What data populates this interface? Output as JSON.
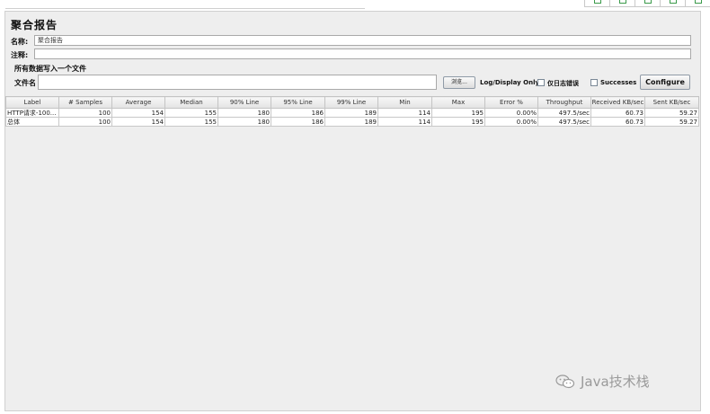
{
  "panel": {
    "title": "聚合报告",
    "name_label": "名称:",
    "name_value": "聚合报告",
    "comment_label": "注释:",
    "comment_value": "",
    "file_section_label": "所有数据写入一个文件",
    "filename_label": "文件名",
    "filename_value": "",
    "browse_label": "浏览...",
    "log_display_label": "Log/Display Only:",
    "errors_only_label": "仅日志错误",
    "successes_label": "Successes",
    "configure_label": "Configure"
  },
  "table": {
    "headers": [
      "Label",
      "# Samples",
      "Average",
      "Median",
      "90% Line",
      "95% Line",
      "99% Line",
      "Min",
      "Max",
      "Error %",
      "Throughput",
      "Received KB/sec",
      "Sent KB/sec"
    ],
    "rows": [
      [
        "HTTP请求-100...",
        "100",
        "154",
        "155",
        "180",
        "186",
        "189",
        "114",
        "195",
        "0.00%",
        "497.5/sec",
        "60.73",
        "59.27"
      ],
      [
        "总体",
        "100",
        "154",
        "155",
        "180",
        "186",
        "189",
        "114",
        "195",
        "0.00%",
        "497.5/sec",
        "60.73",
        "59.27"
      ]
    ]
  },
  "watermark": {
    "text": "Java技术栈",
    "icon": "wechat-icon"
  },
  "toolbar": {
    "icons": [
      "toolbar-icon-1",
      "toolbar-icon-2",
      "toolbar-icon-3",
      "toolbar-icon-4",
      "toolbar-icon-5"
    ]
  }
}
